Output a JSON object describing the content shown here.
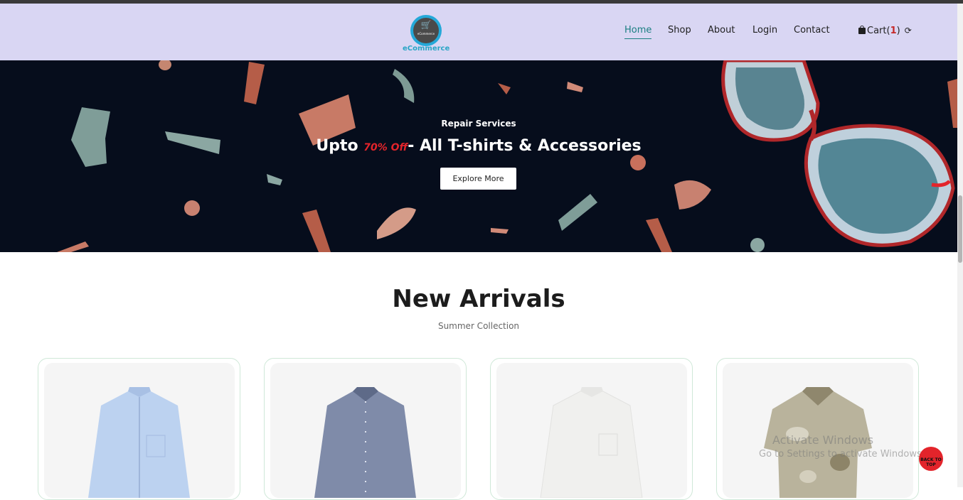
{
  "header": {
    "logo_text": "eCommerce",
    "logo_mini": "eCommerce",
    "nav": [
      {
        "label": "Home",
        "active": true
      },
      {
        "label": "Shop"
      },
      {
        "label": "About"
      },
      {
        "label": "Login"
      },
      {
        "label": "Contact"
      }
    ],
    "cart_label": "Cart",
    "cart_open": "(",
    "cart_count": "1",
    "cart_close": ")"
  },
  "hero": {
    "subtitle": "Repair Services",
    "title_prefix": "Upto ",
    "title_offer": "70% Off",
    "title_suffix": "- All T-shirts & Accessories",
    "button_label": "Explore More"
  },
  "arrivals": {
    "title": "New Arrivals",
    "subtitle": "Summer Collection",
    "products": [
      {
        "image": "light-blue-shirt",
        "color": "#b9cfef"
      },
      {
        "image": "checked-navy-shirt",
        "color": "#7e8aa8"
      },
      {
        "image": "white-shirt",
        "color": "#f0f0ee"
      },
      {
        "image": "floral-beige-shirt",
        "color": "#b7b098"
      }
    ]
  },
  "overlay": {
    "watermark_line1": "Activate Windows",
    "watermark_line2": "Go to Settings to activate Windows.",
    "back_to_top": "BACK TO TOP"
  },
  "colors": {
    "header_bg": "#d9d6f3",
    "hero_bg": "#060d1c",
    "accent_red": "#e3242b",
    "nav_active": "#1b7f82"
  }
}
